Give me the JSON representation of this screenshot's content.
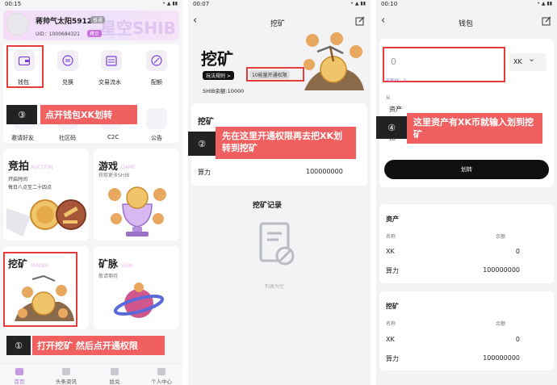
{
  "screen1": {
    "time": "00:15",
    "status_icons": "• ▲ ▮▮",
    "username": "蒋帅气太阳5912",
    "badge_normal": "普通",
    "uid": "UID：1000684321",
    "uid_tag": "拷贝",
    "banner_watermark": "星空SHIB",
    "menu_row1": [
      "钱包",
      "兑换",
      "交易流水",
      "配额"
    ],
    "menu_row2": [
      "邀请好友",
      "社区码",
      "C2C",
      "公告"
    ],
    "auction": {
      "title": "竞拍",
      "watermark": "AUCTION",
      "line1": "开启时间",
      "line2": "每日八点至二十四点"
    },
    "game": {
      "title": "游戏",
      "watermark": "GAME",
      "sub": "获取更多SHIB"
    },
    "mining": {
      "title": "挖矿",
      "watermark": "MINING"
    },
    "vein": {
      "title": "矿脉",
      "watermark": "VEIN",
      "sub": "敬请期待"
    },
    "tabs": [
      "首页",
      "头条资讯",
      "拢兑",
      "个人中心"
    ],
    "callout3_num": "③",
    "callout3_text": "点开钱包XK划转",
    "callout1_num": "①",
    "callout1_text": "打开挖矿 然后点开通权限"
  },
  "screen2": {
    "time": "00:07",
    "status_icons": "• ▲ ▮▮",
    "title": "挖矿",
    "hero_title": "挖矿",
    "rules_btn": "玩法规则 >",
    "open_btn": "10能量开通权限",
    "balance": "SHIB余额:10000",
    "card_title": "挖矿",
    "power_label": "算力",
    "power_value": "100000000",
    "record_title": "挖矿记录",
    "empty_text": "列表为空",
    "callout2_num": "②",
    "callout2_text": "先在这里开通权限再去把XK划转到挖矿"
  },
  "screen3": {
    "time": "00:10",
    "status_icons": "• ▲ ▮▮",
    "title": "钱包",
    "input_value": "0",
    "currency": "XK",
    "available": "可用XK：0",
    "from_label": "从",
    "asset_label": "资产",
    "to_label": "挖",
    "transfer_btn": "划转",
    "callout4_num": "④",
    "callout4_text": "这里资产有XK币就输入划到挖矿",
    "asset_card": {
      "title": "资产",
      "col1": "名称",
      "col2": "余额",
      "rows": [
        {
          "name": "XK",
          "val": "0"
        },
        {
          "name": "算力",
          "val": "100000000"
        }
      ]
    },
    "mining_card": {
      "title": "挖矿",
      "col1": "名称",
      "col2": "余额",
      "rows": [
        {
          "name": "XK",
          "val": "0"
        },
        {
          "name": "算力",
          "val": "100000000"
        }
      ]
    }
  },
  "colors": {
    "accent_red": "#e53b3b",
    "callout_bg": "#f06060",
    "purple": "#7a3fd8"
  }
}
